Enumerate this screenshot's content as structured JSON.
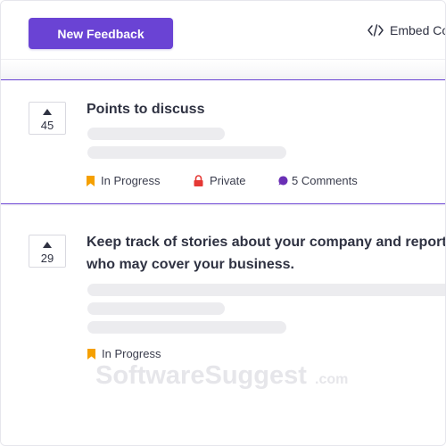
{
  "header": {
    "new_feedback_label": "New Feedback",
    "embed_label": "Embed Co"
  },
  "posts": [
    {
      "votes": "45",
      "title": "Points to discuss",
      "status": "In Progress",
      "visibility": "Private",
      "comments": "5 Comments"
    },
    {
      "votes": "29",
      "title_line1": "Keep track of stories about your company and reporte",
      "title_line2": "who may cover your business.",
      "status": "In Progress"
    }
  ],
  "watermark": "SoftwareSuggest.com",
  "colors": {
    "accent": "#6a43d4",
    "status_in_progress": "#f5a000",
    "private": "#e53935",
    "comments": "#6a2fb5"
  },
  "icons": {
    "vote": "triangle-up-icon",
    "embed": "code-icon",
    "status": "bookmark-icon",
    "private": "lock-icon",
    "comments": "chat-bubble-icon"
  }
}
